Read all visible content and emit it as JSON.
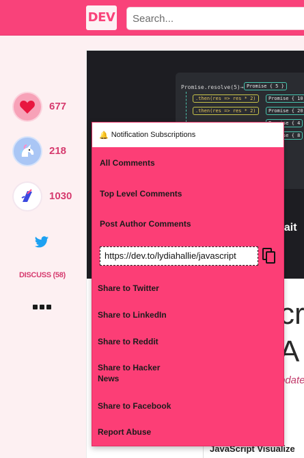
{
  "header": {
    "logo": "DEV",
    "search_placeholder": "Search..."
  },
  "reactions": [
    {
      "name": "heart",
      "count": "677"
    },
    {
      "name": "unicorn",
      "count": "218"
    },
    {
      "name": "bookmark",
      "count": "1030"
    }
  ],
  "sidebar": {
    "discuss_label": "DISCUSS (58)"
  },
  "cover": {
    "code_line1": "Promise.resolve(5)→",
    "chip1": "Promise { 5 }",
    "chip_then1": ".then(res => res * 2)",
    "chip_then2": ".then(res => res * 2)",
    "chip_p2": "Promise { 10",
    "chip_p3": "Promise { 20",
    "chip_p4": "Promise { 4",
    "chip_p5": "Promise { 8",
    "title_fragment": "vait"
  },
  "article": {
    "title_frag1": "cri",
    "title_frag2": "A",
    "updated_frag": "pdate",
    "toc_frag": "JavaScript Visualize"
  },
  "dropdown": {
    "header": "Notification Subscriptions",
    "options": [
      "All Comments",
      "Top Level Comments",
      "Post Author Comments"
    ],
    "url_value": "https://dev.to/lydiahallie/javascript",
    "share": {
      "twitter": "Share to Twitter",
      "linkedin": "Share to LinkedIn",
      "reddit": "Share to Reddit",
      "hacker_news_line1": "Share to Hacker",
      "hacker_news_line2": "News",
      "facebook": "Share to Facebook",
      "report": "Report Abuse"
    }
  },
  "colors": {
    "brand": "#f9427a",
    "dropdown": "#fc3e76",
    "count_text": "#d63a6e"
  }
}
